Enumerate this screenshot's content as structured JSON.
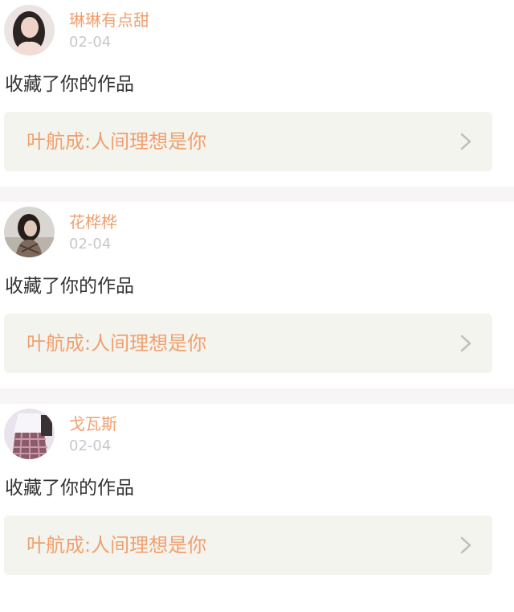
{
  "colors": {
    "username": "#f0a070",
    "work_title": "#f0a070",
    "timestamp": "#c8c8c8",
    "action_text": "#333333",
    "card_bg": "#f4f4ee",
    "gap_bg": "#f7f5f5",
    "chevron": "#bdbdbd"
  },
  "notifications": [
    {
      "avatar_icon": "user-avatar-photo",
      "username": "琳琳有点甜",
      "timestamp": "02-04",
      "action": "收藏了你的作品",
      "work_title": "叶航成:人间理想是你",
      "chevron_icon": "chevron-right-icon"
    },
    {
      "avatar_icon": "user-avatar-photo",
      "username": "花桦桦",
      "timestamp": "02-04",
      "action": "收藏了你的作品",
      "work_title": "叶航成:人间理想是你",
      "chevron_icon": "chevron-right-icon"
    },
    {
      "avatar_icon": "user-avatar-photo",
      "username": "戈瓦斯",
      "timestamp": "02-04",
      "action": "收藏了你的作品",
      "work_title": "叶航成:人间理想是你",
      "chevron_icon": "chevron-right-icon"
    }
  ]
}
